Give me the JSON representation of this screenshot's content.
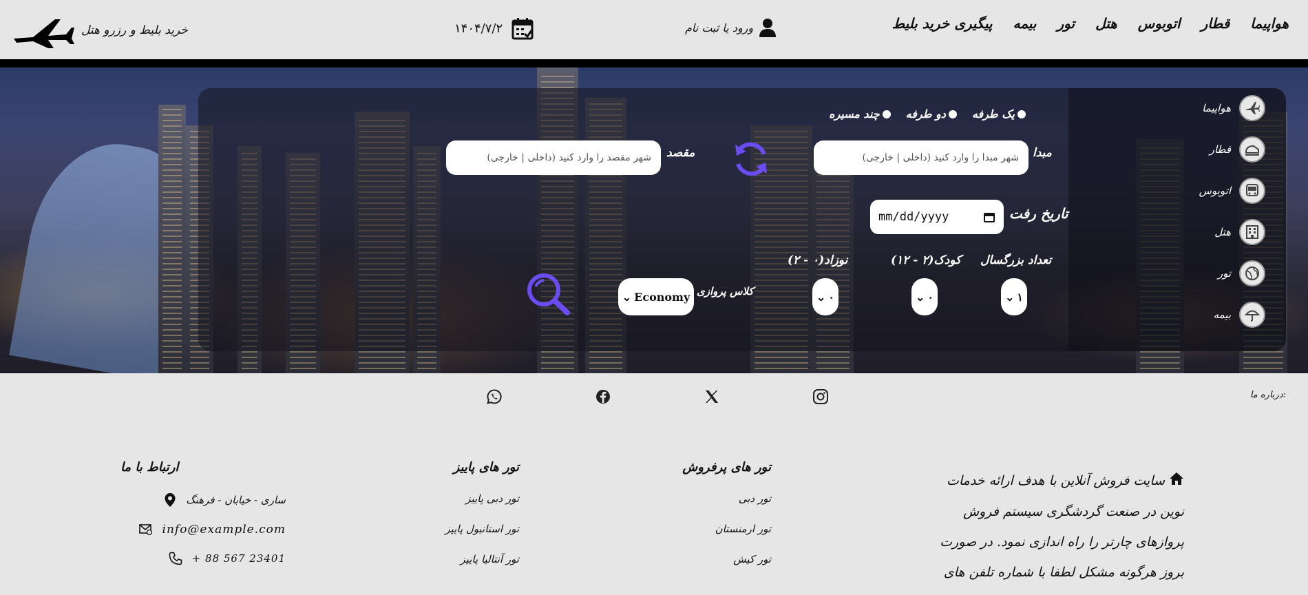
{
  "header": {
    "brand_text": "خرید بلیط و رزرو هتل",
    "date": "۱۴۰۴/۷/۲",
    "login_text": "ورود یا ثبت نام",
    "nav": [
      "هواپیما",
      "قطار",
      "اتوبوس",
      "هتل",
      "تور",
      "بیمه",
      "پیگیری خرید بلیط"
    ]
  },
  "services": [
    {
      "label": "هواپیما",
      "icon": "airplane-icon"
    },
    {
      "label": "قطار",
      "icon": "train-icon"
    },
    {
      "label": "اتوبوس",
      "icon": "bus-icon"
    },
    {
      "label": "هتل",
      "icon": "hotel-icon"
    },
    {
      "label": "تور",
      "icon": "globe-icon"
    },
    {
      "label": "بیمه",
      "icon": "umbrella-icon"
    }
  ],
  "trip_types": [
    "یک طرفه",
    "دو طرفه",
    "چند مسیره"
  ],
  "search": {
    "origin_label": "مبدا",
    "origin_placeholder": "شهر مبدا را وارد کنید (داخلی | خارجی)",
    "destination_label": "مقصد",
    "destination_placeholder": "شهر مقصد را وارد کنید (داخلی | خارجی)",
    "depart_label": "تاریخ رفت",
    "date_placeholder": "mm/dd/yyyy",
    "adults_label": "تعداد بزرگسال",
    "adults_value": "۱",
    "children_label": "کودک(۲ - ۱۲)",
    "children_value": "۰",
    "infants_label": "نوزاد(۰ - ۲)",
    "infants_value": "۰",
    "class_label": "کلاس پروازی",
    "class_value": "Economy"
  },
  "social": {
    "about_label": "درباره ما:",
    "icons": [
      "instagram-icon",
      "x-icon",
      "facebook-icon",
      "whatsapp-icon"
    ]
  },
  "footer": {
    "about_text": "سایت فروش آنلاین با هدف ارائه خدمات نوین در صنعت گردشگری سیستم فروش پروازهای چارتر را راه اندازی نمود. در صورت بروز هرگونه مشکل لطفا با شماره تلفن های اعلام شده در انتهای صفحه تماس حاصل نمایید",
    "popular_title": "تور های پرفروش",
    "popular_links": [
      "تور دبی",
      "تور ارمنستان",
      "تور کیش"
    ],
    "autumn_title": "تور های پاییز",
    "autumn_links": [
      "تور دبی پاییز",
      "تور استانبول پاییز",
      "تور آنتالیا پاییز"
    ],
    "contact_title": "ارتباط با ما",
    "address": "ساری - خیابان - فرهنگ",
    "email": "info@example.com",
    "phone": "+ 88 567 23401"
  },
  "colors": {
    "accent": "#6a4cf0",
    "panel": "#14141e"
  }
}
